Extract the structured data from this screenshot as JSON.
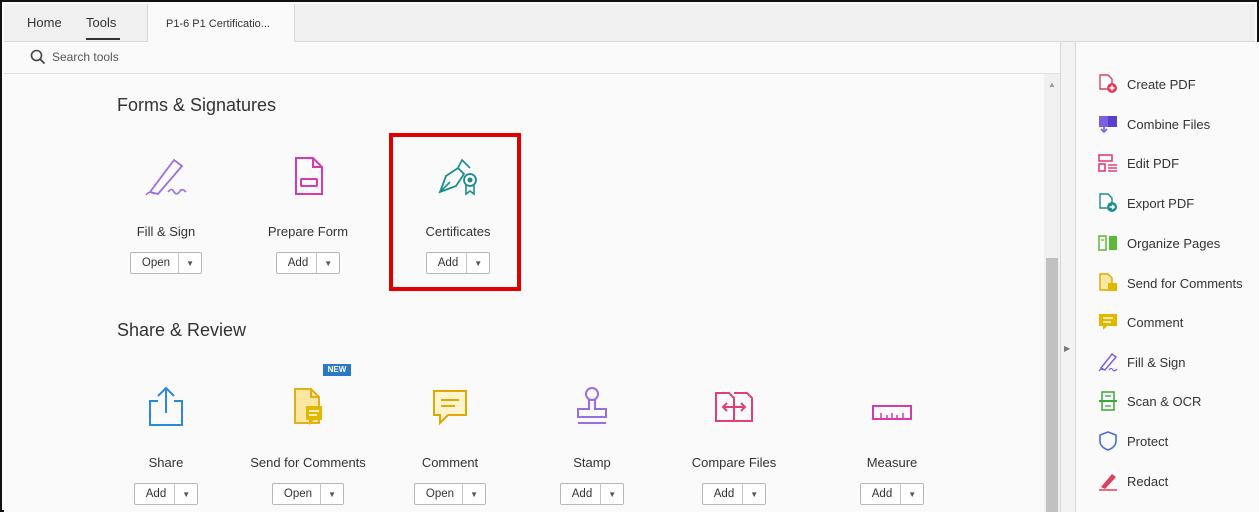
{
  "tabs": {
    "home": "Home",
    "tools": "Tools",
    "document": "P1-6 P1 Certificatio..."
  },
  "search": {
    "placeholder": "Search tools"
  },
  "sections": [
    {
      "title": "Forms & Signatures"
    },
    {
      "title": "Share & Review"
    }
  ],
  "forms_tools": [
    {
      "label": "Fill & Sign",
      "button": "Open",
      "icon": "fill-sign-icon"
    },
    {
      "label": "Prepare Form",
      "button": "Add",
      "icon": "prepare-form-icon"
    },
    {
      "label": "Certificates",
      "button": "Add",
      "icon": "certificates-icon",
      "highlighted": true
    }
  ],
  "review_tools": [
    {
      "label": "Share",
      "button": "Add",
      "icon": "share-icon"
    },
    {
      "label": "Send for Comments",
      "button": "Open",
      "icon": "send-for-comments-icon",
      "badge": "NEW"
    },
    {
      "label": "Comment",
      "button": "Open",
      "icon": "comment-icon"
    },
    {
      "label": "Stamp",
      "button": "Add",
      "icon": "stamp-icon"
    },
    {
      "label": "Compare Files",
      "button": "Add",
      "icon": "compare-files-icon"
    },
    {
      "label": "Measure",
      "button": "Add",
      "icon": "measure-icon"
    }
  ],
  "right_panel": [
    {
      "label": "Create PDF",
      "icon": "create-pdf-icon"
    },
    {
      "label": "Combine Files",
      "icon": "combine-files-icon"
    },
    {
      "label": "Edit PDF",
      "icon": "edit-pdf-icon"
    },
    {
      "label": "Export PDF",
      "icon": "export-pdf-icon"
    },
    {
      "label": "Organize Pages",
      "icon": "organize-pages-icon"
    },
    {
      "label": "Send for Comments",
      "icon": "send-for-comments-icon"
    },
    {
      "label": "Comment",
      "icon": "comment-icon"
    },
    {
      "label": "Fill & Sign",
      "icon": "fill-sign-icon"
    },
    {
      "label": "Scan & OCR",
      "icon": "scan-ocr-icon"
    },
    {
      "label": "Protect",
      "icon": "protect-icon"
    },
    {
      "label": "Redact",
      "icon": "redact-icon"
    }
  ],
  "colors": {
    "highlight": "#e00000",
    "badge": "#2b77c9"
  }
}
